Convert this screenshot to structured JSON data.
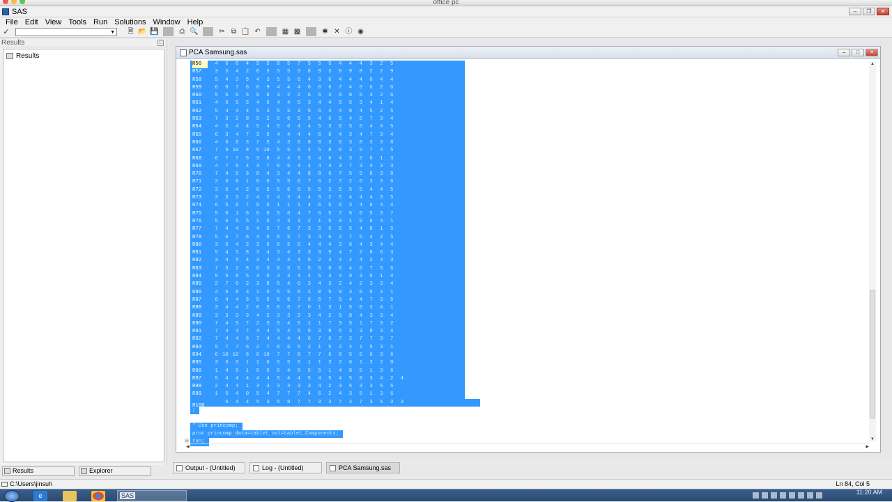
{
  "mac_window_title": "office pc",
  "app": {
    "title": "SAS"
  },
  "menu": [
    "File",
    "Edit",
    "View",
    "Tools",
    "Run",
    "Solutions",
    "Window",
    "Help"
  ],
  "toolbar_icons": [
    "new-icon",
    "open-icon",
    "save-icon",
    "print-icon",
    "print-preview-icon",
    "cut-icon",
    "copy-icon",
    "paste-icon",
    "undo-icon",
    "libraries-icon",
    "explorer-icon",
    "submit-icon",
    "clear-icon",
    "help-icon",
    "sas-help-icon"
  ],
  "results_pane": {
    "header": "Results",
    "tree_root": "Results"
  },
  "left_tabs": [
    "Results",
    "Explorer"
  ],
  "editor": {
    "title": "PCA Samsung.sas",
    "rows": [
      {
        "label": "R56",
        "vals": [
          "4",
          "6",
          "6",
          "4",
          "5",
          "5",
          "6",
          "5",
          "7",
          "5",
          "5",
          "5",
          "4",
          "4",
          "4",
          "3",
          "2",
          "5"
        ]
      },
      {
        "label": "R57",
        "vals": [
          "3",
          "5",
          "4",
          "2",
          "8",
          "5",
          "5",
          "5",
          "5",
          "8",
          "9",
          "3",
          "8",
          "9",
          "8",
          "2",
          "2",
          "9"
        ]
      },
      {
        "label": "R58",
        "vals": [
          "5",
          "4",
          "3",
          "5",
          "4",
          "3",
          "5",
          "5",
          "6",
          "4",
          "3",
          "6",
          "4",
          "4",
          "4",
          "6",
          "4",
          "4"
        ]
      },
      {
        "label": "R59",
        "vals": [
          "6",
          "8",
          "7",
          "6",
          "6",
          "9",
          "4",
          "4",
          "4",
          "6",
          "6",
          "6",
          "7",
          "4",
          "6",
          "6",
          "2",
          "6"
        ]
      },
      {
        "label": "R60",
        "vals": [
          "5",
          "6",
          "6",
          "5",
          "6",
          "6",
          "3",
          "2",
          "2",
          "6",
          "5",
          "4",
          "6",
          "8",
          "6",
          "4",
          "2",
          "6"
        ]
      },
      {
        "label": "R61",
        "vals": [
          "4",
          "6",
          "5",
          "5",
          "4",
          "6",
          "4",
          "4",
          "5",
          "3",
          "4",
          "4",
          "5",
          "5",
          "3",
          "4",
          "1",
          "4"
        ]
      },
      {
        "label": "R62",
        "vals": [
          "5",
          "4",
          "4",
          "4",
          "5",
          "3",
          "5",
          "5",
          "3",
          "5",
          "6",
          "4",
          "4",
          "8",
          "4",
          "5",
          "2",
          "5"
        ]
      },
      {
        "label": "R63",
        "vals": [
          "7",
          "3",
          "2",
          "8",
          "5",
          "2",
          "6",
          "6",
          "5",
          "5",
          "4",
          "6",
          "5",
          "4",
          "5",
          "7",
          "3",
          "4"
        ]
      },
      {
        "label": "R64",
        "vals": [
          "4",
          "5",
          "4",
          "4",
          "5",
          "4",
          "5",
          "6",
          "4",
          "4",
          "5",
          "3",
          "6",
          "5",
          "5",
          "4",
          "4",
          "5"
        ]
      },
      {
        "label": "R65",
        "vals": [
          "6",
          "3",
          "4",
          "7",
          "3",
          "5",
          "4",
          "4",
          "4",
          "4",
          "6",
          "6",
          "4",
          "3",
          "4",
          "7",
          "3",
          "4"
        ]
      },
      {
        "label": "R66",
        "vals": [
          "4",
          "6",
          "6",
          "3",
          "7",
          "5",
          "4",
          "3",
          "5",
          "8",
          "8",
          "3",
          "6",
          "3",
          "8",
          "3",
          "3",
          "8"
        ]
      },
      {
        "label": "R67",
        "vals": [
          "7",
          "9",
          "10",
          "8",
          "5",
          "10",
          "5",
          "5",
          "5",
          "4",
          "5",
          "8",
          "6",
          "3",
          "5",
          "7",
          "4",
          "5"
        ]
      },
      {
        "label": "R68",
        "vals": [
          "6",
          "7",
          "7",
          "5",
          "3",
          "8",
          "4",
          "4",
          "3",
          "3",
          "4",
          "6",
          "4",
          "3",
          "2",
          "6",
          "1",
          "3"
        ]
      },
      {
        "label": "R69",
        "vals": [
          "4",
          "7",
          "6",
          "4",
          "4",
          "7",
          "6",
          "5",
          "4",
          "4",
          "4",
          "4",
          "3",
          "7",
          "3",
          "4",
          "3",
          "3"
        ]
      },
      {
        "label": "R70",
        "vals": [
          "7",
          "4",
          "5",
          "6",
          "8",
          "4",
          "3",
          "4",
          "4",
          "8",
          "8",
          "6",
          "7",
          "5",
          "9",
          "8",
          "3",
          "8"
        ]
      },
      {
        "label": "R71",
        "vals": [
          "2",
          "6",
          "6",
          "1",
          "6",
          "6",
          "5",
          "5",
          "6",
          "7",
          "6",
          "2",
          "7",
          "2",
          "6",
          "3",
          "3",
          "6"
        ]
      },
      {
        "label": "R72",
        "vals": [
          "3",
          "5",
          "4",
          "2",
          "6",
          "5",
          "5",
          "6",
          "6",
          "5",
          "5",
          "3",
          "5",
          "5",
          "5",
          "4",
          "4",
          "5"
        ]
      },
      {
        "label": "R73",
        "vals": [
          "3",
          "3",
          "3",
          "2",
          "4",
          "2",
          "4",
          "3",
          "4",
          "4",
          "3",
          "2",
          "5",
          "4",
          "4",
          "4",
          "3",
          "5"
        ]
      },
      {
        "label": "R74",
        "vals": [
          "6",
          "5",
          "6",
          "7",
          "5",
          "5",
          "1",
          "1",
          "1",
          "4",
          "6",
          "5",
          "6",
          "3",
          "4",
          "6",
          "4",
          "4"
        ]
      },
      {
        "label": "R75",
        "vals": [
          "5",
          "0",
          "1",
          "6",
          "6",
          "0",
          "5",
          "6",
          "4",
          "7",
          "6",
          "5",
          "7",
          "6",
          "6",
          "5",
          "3",
          "7"
        ]
      },
      {
        "label": "R76",
        "vals": [
          "5",
          "6",
          "5",
          "5",
          "1",
          "5",
          "4",
          "3",
          "3",
          "2",
          "1",
          "5",
          "0",
          "1",
          "0",
          "6",
          "4",
          "1"
        ]
      },
      {
        "label": "R77",
        "vals": [
          "7",
          "4",
          "4",
          "6",
          "4",
          "5",
          "7",
          "6",
          "7",
          "3",
          "5",
          "6",
          "5",
          "5",
          "4",
          "8",
          "1",
          "5"
        ]
      },
      {
        "label": "R78",
        "vals": [
          "5",
          "6",
          "7",
          "6",
          "4",
          "5",
          "6",
          "5",
          "7",
          "3",
          "4",
          "6",
          "3",
          "7",
          "5",
          "4",
          "2",
          "5"
        ]
      },
      {
        "label": "R80",
        "vals": [
          "3",
          "5",
          "4",
          "2",
          "3",
          "6",
          "5",
          "5",
          "5",
          "4",
          "4",
          "4",
          "2",
          "6",
          "4",
          "3",
          "4",
          "4"
        ]
      },
      {
        "label": "R81",
        "vals": [
          "5",
          "4",
          "5",
          "8",
          "3",
          "4",
          "3",
          "4",
          "3",
          "3",
          "3",
          "9",
          "4",
          "7",
          "2",
          "8",
          "6",
          "3"
        ]
      },
      {
        "label": "R82",
        "vals": [
          "3",
          "4",
          "5",
          "4",
          "3",
          "4",
          "4",
          "4",
          "4",
          "5",
          "2",
          "3",
          "4",
          "4",
          "4",
          "2",
          "4",
          "3"
        ]
      },
      {
        "label": "R83",
        "vals": [
          "7",
          "3",
          "2",
          "8",
          "6",
          "3",
          "6",
          "5",
          "5",
          "5",
          "6",
          "8",
          "6",
          "4",
          "6",
          "7",
          "5",
          "6"
        ]
      },
      {
        "label": "R84",
        "vals": [
          "5",
          "5",
          "6",
          "5",
          "4",
          "5",
          "4",
          "3",
          "4",
          "4",
          "5",
          "4",
          "4",
          "9",
          "3",
          "5",
          "1",
          "4"
        ]
      },
      {
        "label": "R85",
        "vals": [
          "2",
          "7",
          "6",
          "2",
          "3",
          "8",
          "5",
          "4",
          "6",
          "3",
          "4",
          "3",
          "2",
          "4",
          "2",
          "3",
          "3",
          "4"
        ]
      },
      {
        "label": "R86",
        "vals": [
          "4",
          "6",
          "6",
          "3",
          "1",
          "5",
          "5",
          "5",
          "6",
          "1",
          "0",
          "5",
          "0",
          "3",
          "0",
          "5",
          "3",
          "1"
        ]
      },
      {
        "label": "R87",
        "vals": [
          "6",
          "4",
          "4",
          "5",
          "5",
          "5",
          "6",
          "6",
          "7",
          "6",
          "5",
          "7",
          "5",
          "4",
          "4",
          "7",
          "3",
          "5"
        ]
      },
      {
        "label": "R88",
        "vals": [
          "3",
          "4",
          "4",
          "2",
          "0",
          "5",
          "6",
          "6",
          "7",
          "0",
          "1",
          "3",
          "1",
          "5",
          "0",
          "3",
          "4",
          "1"
        ]
      },
      {
        "label": "R89",
        "vals": [
          "3",
          "3",
          "3",
          "3",
          "4",
          "2",
          "3",
          "3",
          "2",
          "3",
          "4",
          "2",
          "5",
          "8",
          "4",
          "3",
          "3",
          "4"
        ]
      },
      {
        "label": "R90",
        "vals": [
          "7",
          "4",
          "5",
          "7",
          "2",
          "3",
          "5",
          "4",
          "5",
          "1",
          "1",
          "7",
          "3",
          "5",
          "1",
          "7",
          "3",
          "2"
        ]
      },
      {
        "label": "R91",
        "vals": [
          "7",
          "4",
          "4",
          "7",
          "4",
          "4",
          "5",
          "4",
          "5",
          "5",
          "3",
          "8",
          "5",
          "3",
          "3",
          "8",
          "3",
          "4"
        ]
      },
      {
        "label": "R92",
        "vals": [
          "7",
          "4",
          "4",
          "6",
          "7",
          "4",
          "4",
          "4",
          "4",
          "6",
          "7",
          "6",
          "7",
          "2",
          "7",
          "7",
          "3",
          "7"
        ]
      },
      {
        "label": "R93",
        "vals": [
          "5",
          "7",
          "7",
          "5",
          "2",
          "7",
          "6",
          "6",
          "5",
          "2",
          "1",
          "5",
          "2",
          "4",
          "1",
          "5",
          "3",
          "1"
        ]
      },
      {
        "label": "R94",
        "vals": [
          "6",
          "10",
          "10",
          "6",
          "6",
          "10",
          "7",
          "7",
          "8",
          "7",
          "7",
          "6",
          "6",
          "5",
          "6",
          "6",
          "3",
          "6"
        ]
      },
      {
        "label": "R95",
        "vals": [
          "3",
          "6",
          "5",
          "1",
          "1",
          "6",
          "5",
          "5",
          "5",
          "1",
          "1",
          "3",
          "2",
          "6",
          "1",
          "3",
          "2",
          "0"
        ]
      },
      {
        "label": "R96",
        "vals": [
          "1",
          "4",
          "5",
          "1",
          "5",
          "5",
          "5",
          "4",
          "5",
          "5",
          "5",
          "1",
          "4",
          "8",
          "5",
          "1",
          "3",
          "6"
        ]
      },
      {
        "label": "R97",
        "vals": [
          "5",
          "4",
          "4",
          "4",
          "4",
          "4",
          "5",
          "4",
          "4",
          "5",
          "4",
          "5",
          "4",
          "5",
          "8",
          "3",
          "4",
          "2",
          "4"
        ]
      },
      {
        "label": "R98",
        "vals": [
          "2",
          "4",
          "4",
          "1",
          "3",
          "3",
          "3",
          "3",
          "3",
          "3",
          "4",
          "2",
          "3",
          "5",
          "3",
          "3",
          "5",
          "5"
        ]
      },
      {
        "label": "R99",
        "vals": [
          "1",
          "5",
          "4",
          "0",
          "5",
          "4",
          "7",
          "7",
          "7",
          "4",
          "6",
          "2",
          "4",
          "3",
          "5",
          "1",
          "3",
          "6"
        ]
      },
      {
        "label": "R100",
        "vals": [
          "",
          "6",
          "4",
          "4",
          "5",
          "3",
          "5",
          "8",
          "7",
          "7",
          "3",
          "3",
          "7",
          "3",
          "7",
          "3",
          "6",
          "3",
          "3"
        ]
      }
    ],
    "after_data": ";",
    "comment": "* Use princomp;",
    "proc": "proc princomp data=tablet out=tablet_Components;",
    "run": "run;"
  },
  "window_tabs": [
    "Output - (Untitled)",
    "Log - (Untitled)",
    "PCA Samsung.sas"
  ],
  "status": {
    "path": "C:\\Users\\jinsuh",
    "position": "Ln 84, Col 5"
  },
  "taskbar": {
    "active_app": "SAS",
    "time": "11:20 AM"
  }
}
